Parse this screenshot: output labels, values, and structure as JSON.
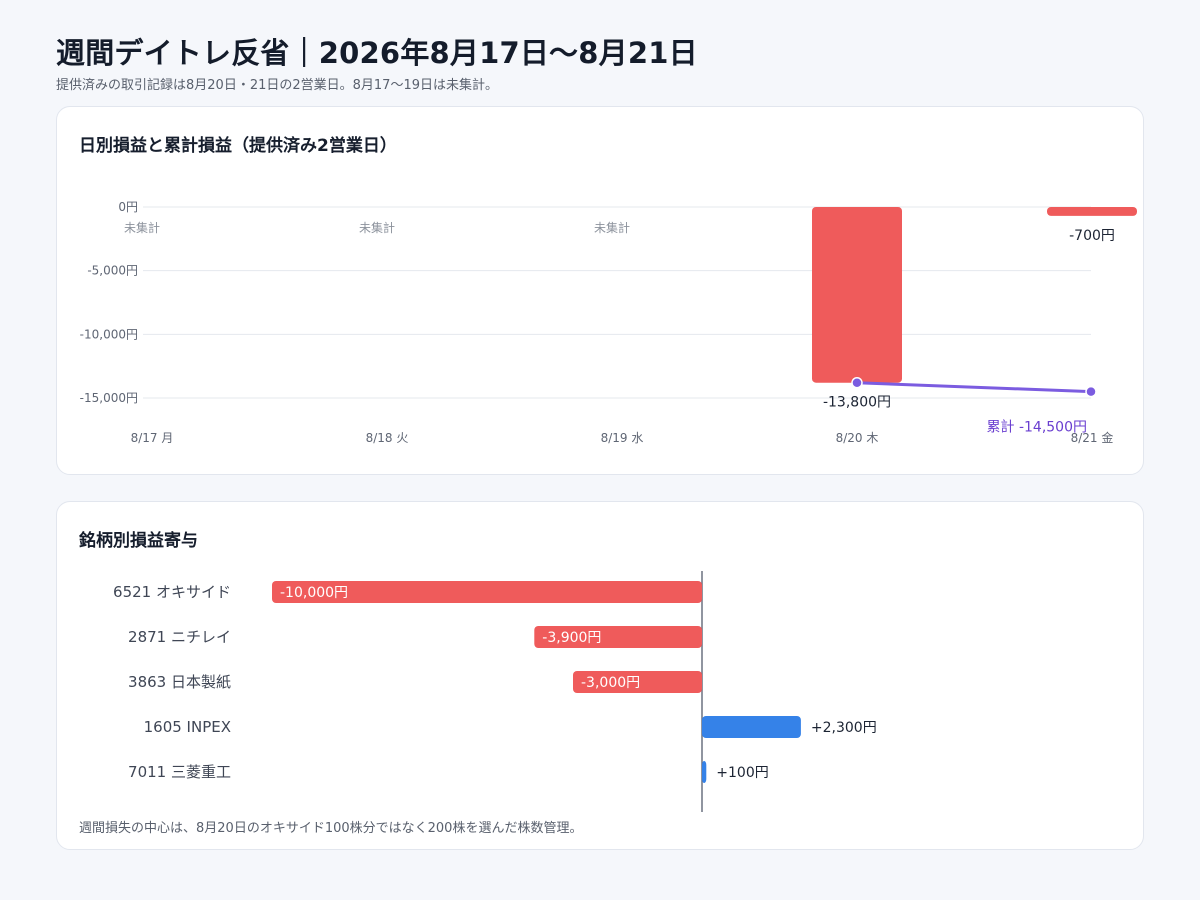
{
  "page": {
    "title": "週間デイトレ反省｜2026年8月17日〜8月21日",
    "subtitle": "提供済みの取引記録は8月20日・21日の2営業日。8月17〜19日は未集計。"
  },
  "colors": {
    "loss": "#ef5b5b",
    "gain": "#3582e8",
    "cumulative": "#7b5ce0",
    "cumulative_text": "#6a3fd0",
    "grid": "#e5e8ee",
    "axis": "#6b7280"
  },
  "chart_data": [
    {
      "type": "bar",
      "title": "日別損益と累計損益（提供済み2営業日）",
      "categories": [
        "8/17 月",
        "8/18 火",
        "8/19 水",
        "8/20 木",
        "8/21 金"
      ],
      "series": [
        {
          "values": [
            null,
            null,
            null,
            -13800,
            -700
          ]
        },
        {
          "type": "line",
          "values": [
            null,
            null,
            null,
            -13800,
            -14500
          ]
        }
      ],
      "data_labels": [
        "",
        "",
        "",
        "-13,800円",
        "-700円"
      ],
      "missing_label": "未集計",
      "cumulative_label": "累計 -14,500円",
      "y_ticks": [
        0,
        -5000,
        -10000,
        -15000
      ],
      "y_tick_labels": [
        "0円",
        "-5,000円",
        "-10,000円",
        "-15,000円"
      ],
      "ylim": [
        -16000,
        0
      ],
      "grid": true
    },
    {
      "type": "bar",
      "orientation": "horizontal",
      "title": "銘柄別損益寄与",
      "categories": [
        "6521 オキサイド",
        "2871 ニチレイ",
        "3863 日本製紙",
        "1605 INPEX",
        "7011 三菱重工"
      ],
      "values": [
        -10000,
        -3900,
        -3000,
        2300,
        100
      ],
      "data_labels": [
        "-10,000円",
        "-3,900円",
        "-3,000円",
        "+2,300円",
        "+100円"
      ],
      "note": "週間損失の中心は、8月20日のオキサイド100株分ではなく200株を選んだ株数管理。"
    }
  ]
}
